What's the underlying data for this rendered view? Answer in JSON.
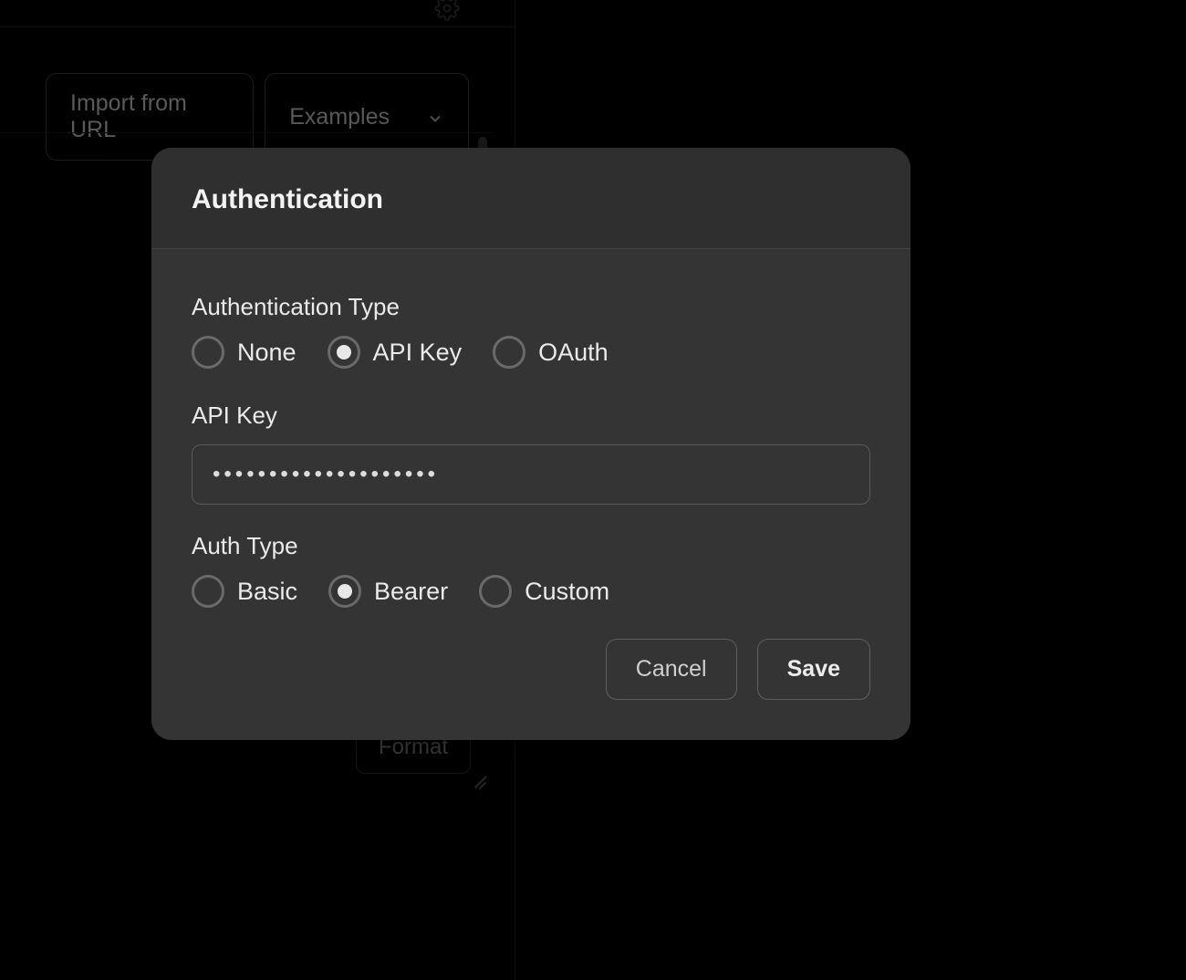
{
  "background": {
    "import_from_url": "Import from URL",
    "examples": "Examples",
    "format": "Format"
  },
  "modal": {
    "title": "Authentication",
    "auth_type_label": "Authentication Type",
    "auth_type_options": {
      "none": "None",
      "api_key": "API Key",
      "oauth": "OAuth"
    },
    "auth_type_selected": "api_key",
    "api_key_label": "API Key",
    "api_key_value": "••••••••••••••••••••",
    "auth_method_label": "Auth Type",
    "auth_method_options": {
      "basic": "Basic",
      "bearer": "Bearer",
      "custom": "Custom"
    },
    "auth_method_selected": "bearer",
    "buttons": {
      "cancel": "Cancel",
      "save": "Save"
    }
  }
}
